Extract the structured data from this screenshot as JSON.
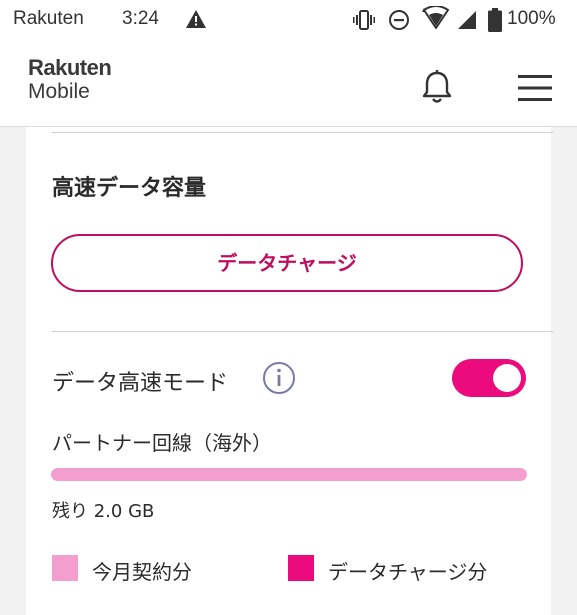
{
  "status_bar": {
    "carrier": "Rakuten",
    "time": "3:24",
    "battery": "100%",
    "icons": [
      "warning-icon",
      "vibrate-icon",
      "do-not-disturb-icon",
      "wifi-icon",
      "signal-icon",
      "battery-icon"
    ]
  },
  "header": {
    "logo_top": "Rakuten",
    "logo_bottom": "Mobile",
    "icons": [
      "bell-icon",
      "hamburger-menu-icon"
    ]
  },
  "card": {
    "title": "高速データ容量",
    "charge_button": "データチャージ",
    "mode_label": "データ高速モード",
    "mode_enabled": true,
    "line_label": "パートナー回線（海外）",
    "usage_fraction_remaining": 1.0,
    "remaining_text": "残り 2.0 GB",
    "legend": [
      {
        "label": "今月契約分",
        "color": "#f49ed0"
      },
      {
        "label": "データチャージ分",
        "color": "#eb0b7c"
      }
    ]
  },
  "colors": {
    "brand": "#bf0d5f",
    "accent": "#eb0b7c",
    "bar_fill": "#f49ed0"
  }
}
